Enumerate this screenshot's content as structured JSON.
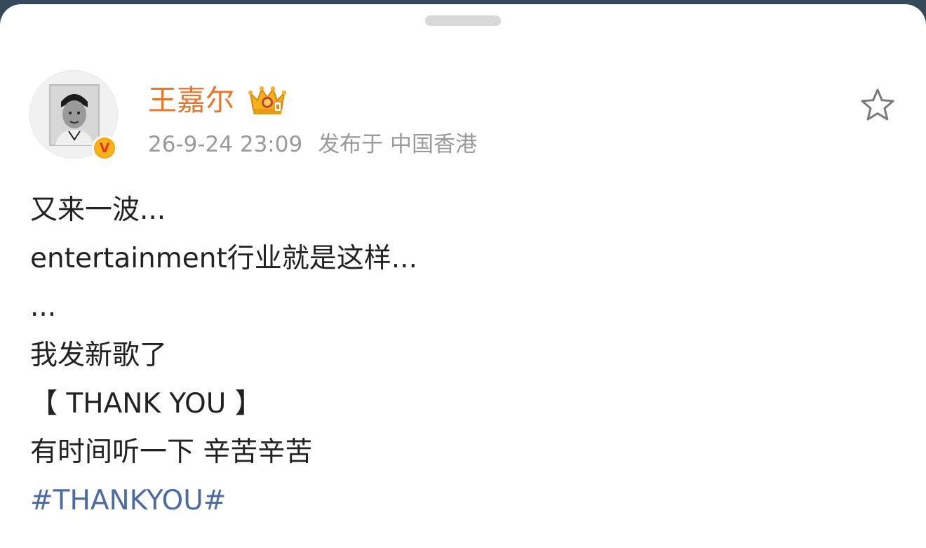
{
  "post": {
    "author": {
      "name": "王嘉尔",
      "verified_badge": "V",
      "avatar": "avatar-photo",
      "crown": "crown-icon"
    },
    "meta": {
      "datetime": "26-9-24 23:09",
      "location": "发布于 中国香港"
    },
    "favorite_icon": "star-outline-icon",
    "lines": [
      "又来一波...",
      "entertainment行业就是这样...",
      "...",
      "我发新歌了",
      "【 THANK YOU 】",
      "有时间听一下 辛苦辛苦"
    ],
    "hashtag": "#THANKYOU#"
  },
  "colors": {
    "username": "#e8772e",
    "hashtag": "#4c6aa3",
    "meta": "#9a9a9a",
    "badge": "#f6a70f"
  }
}
